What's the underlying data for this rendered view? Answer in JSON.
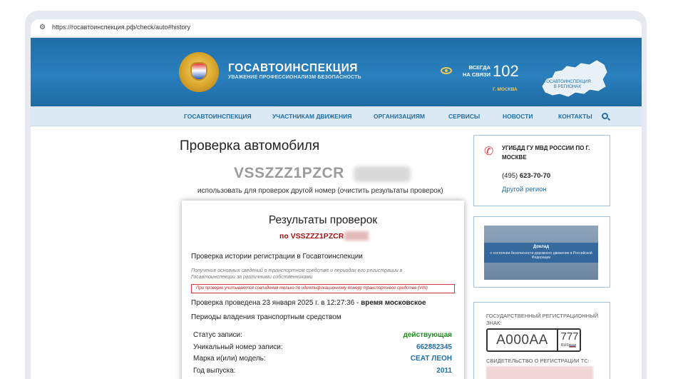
{
  "browser": {
    "url": "https://госавтоинспекция.рф/check/auto#history"
  },
  "header": {
    "brand": "ГОСАВТОИНСПЕКЦИЯ",
    "slogan": "УВАЖЕНИЕ ПРОФЕССИОНАЛИЗМ БЕЗОПАСНОСТЬ",
    "always_line1": "ВСЕГДА",
    "always_line2": "НА СВЯЗИ",
    "hotline": "102",
    "city": "Г. МОСКВА",
    "regions_label": "ГОСАВТОИНСПЕКЦИЯ В РЕГИОНАХ"
  },
  "nav": {
    "items": [
      "ГОСАВТОИНСПЕКЦИЯ",
      "УЧАСТНИКАМ ДВИЖЕНИЯ",
      "ОРГАНИЗАЦИЯМ",
      "СЕРВИСЫ",
      "НОВОСТИ",
      "КОНТАКТЫ"
    ],
    "search_icon": "search-icon"
  },
  "main": {
    "title": "Проверка автомобиля",
    "vin_visible": "VSSZZZ1PZCR",
    "other_number_text": "использовать для проверок другой номер (очистить результаты проверок)"
  },
  "results": {
    "title": "Результаты проверок",
    "plate_prefix": "по VSSZZZ1PZCR",
    "section_title": "Проверка истории регистрации в Госавтоинспекции",
    "section_desc": "Получение основных сведений о транспортном средстве и периодах его регистрации в Госавтоинспекции за различными собственниками",
    "warning": "При проверке учитываются совпадения только по идентификационному номеру транспортного средства (VIN)",
    "checked_prefix": "Проверка проведена 23 января 2025 г. в 12:27:36 -",
    "checked_suffix": "время московское",
    "periods_title": "Периоды владения транспортным средством",
    "rows": [
      {
        "label": "Статус записи:",
        "value": "действующая",
        "color": "#1e8a1e"
      },
      {
        "label": "Уникальный номер записи:",
        "value": "662882345",
        "color": "#1f6ea8"
      },
      {
        "label": "Марка и(или) модель:",
        "value": "СЕАТ ЛЕОН",
        "color": "#1f6ea8"
      },
      {
        "label": "Год выпуска:",
        "value": "2011",
        "color": "#1f6ea8"
      }
    ]
  },
  "sidebar": {
    "contact_title": "УГИБДД ГУ МВД РОССИИ ПО Г. МОСКВЕ",
    "phone_code": "(495)",
    "phone_number": "623-70-70",
    "other_region": "Другой регион",
    "report_title": "Доклад",
    "report_subtitle": "о состоянии безопасности дорожного движения в Российской Федерации",
    "gos_label": "ГОСУДАРСТВЕННЫЙ РЕГИСТРАЦИОННЫЙ ЗНАК:",
    "plate_main": "А000АА",
    "plate_region": "777",
    "plate_rus": "RUS",
    "svid_label": "СВИДЕТЕЛЬСТВО О РЕГИСТРАЦИИ ТС:"
  }
}
